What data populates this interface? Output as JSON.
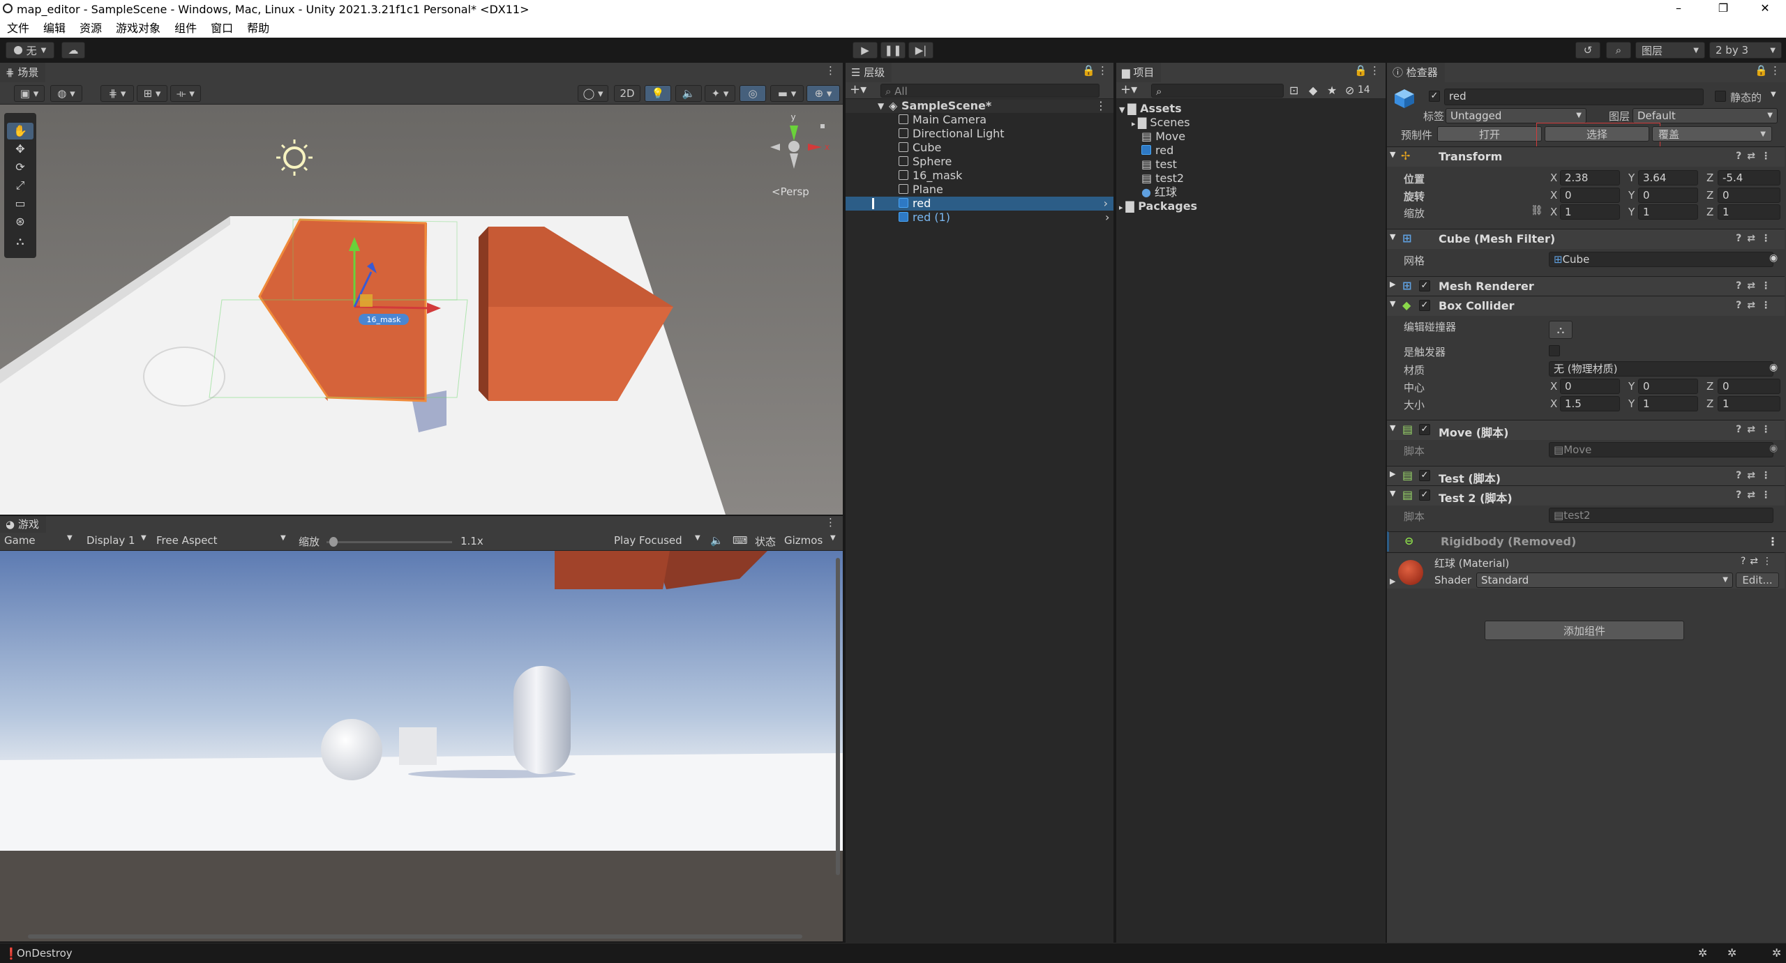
{
  "title_bar": {
    "title": "map_editor - SampleScene - Windows, Mac, Linux - Unity 2021.3.21f1c1 Personal* <DX11>",
    "minimize": "–",
    "maximize": "❐",
    "close": "✕"
  },
  "menu": [
    "文件",
    "编辑",
    "资源",
    "游戏对象",
    "组件",
    "窗口",
    "帮助"
  ],
  "toolbar": {
    "account": "无",
    "layers": "图层",
    "layout": "2 by 3"
  },
  "scene": {
    "tab": "场景",
    "btn_2d": "2D",
    "persp": "<Persp",
    "label_mask": "16_mask",
    "gizmo_y": "y",
    "gizmo_x": "x"
  },
  "game": {
    "tab": "游戏",
    "mode": "Game",
    "display": "Display 1",
    "aspect": "Free Aspect",
    "scale_label": "缩放",
    "scale_value": "1.1x",
    "play_focused": "Play Focused",
    "stats": "状态",
    "gizmos": "Gizmos"
  },
  "hierarchy": {
    "tab": "层级",
    "search": "All",
    "scene": "SampleScene*",
    "items": [
      "Main Camera",
      "Directional Light",
      "Cube",
      "Sphere",
      "16_mask",
      "Plane",
      "red",
      "red (1)"
    ]
  },
  "project": {
    "tab": "项目",
    "hidden_count": "14",
    "assets": "Assets",
    "items": [
      "Scenes",
      "Move",
      "red",
      "test",
      "test2",
      "红球"
    ],
    "packages": "Packages"
  },
  "inspector": {
    "tab": "检查器",
    "object_name": "red",
    "static": "静态的",
    "tag_label": "标签",
    "tag_value": "Untagged",
    "layer_label": "图层",
    "layer_value": "Default",
    "prefab_label": "预制件",
    "prefab_open": "打开",
    "prefab_select": "选择",
    "prefab_override": "覆盖",
    "transform": {
      "title": "Transform",
      "position_label": "位置",
      "rotation_label": "旋转",
      "scale_label": "缩放",
      "position": [
        "2.38",
        "3.64",
        "-5.4"
      ],
      "rotation": [
        "0",
        "0",
        "0"
      ],
      "scale": [
        "1",
        "1",
        "1"
      ]
    },
    "mesh_filter": {
      "title": "Cube (Mesh Filter)",
      "mesh_label": "网格",
      "mesh_value": "Cube"
    },
    "mesh_renderer": {
      "title": "Mesh Renderer"
    },
    "box_collider": {
      "title": "Box Collider",
      "edit_label": "编辑碰撞器",
      "trigger_label": "是触发器",
      "material_label": "材质",
      "material_value": "无 (物理材质)",
      "center_label": "中心",
      "center": [
        "0",
        "0",
        "0"
      ],
      "size_label": "大小",
      "size": [
        "1.5",
        "1",
        "1"
      ]
    },
    "move_script": {
      "title": "Move  (脚本)",
      "script_label": "脚本",
      "script_value": "Move"
    },
    "test_script": {
      "title": "Test  (脚本)"
    },
    "test2_script": {
      "title": "Test 2  (脚本)",
      "script_label": "脚本",
      "script_value": "test2"
    },
    "rigidbody": {
      "title": "Rigidbody (Removed)"
    },
    "material": {
      "title": "红球 (Material)",
      "shader_label": "Shader",
      "shader_value": "Standard",
      "edit": "Edit..."
    },
    "add_component": "添加组件"
  },
  "status_bar": {
    "message": "OnDestroy"
  },
  "xyz": {
    "x": "X",
    "y": "Y",
    "z": "Z"
  },
  "colors": {
    "accent": "#2c5d87",
    "selected_row": "#2c5d87",
    "cube_orange": "#d55a32"
  }
}
